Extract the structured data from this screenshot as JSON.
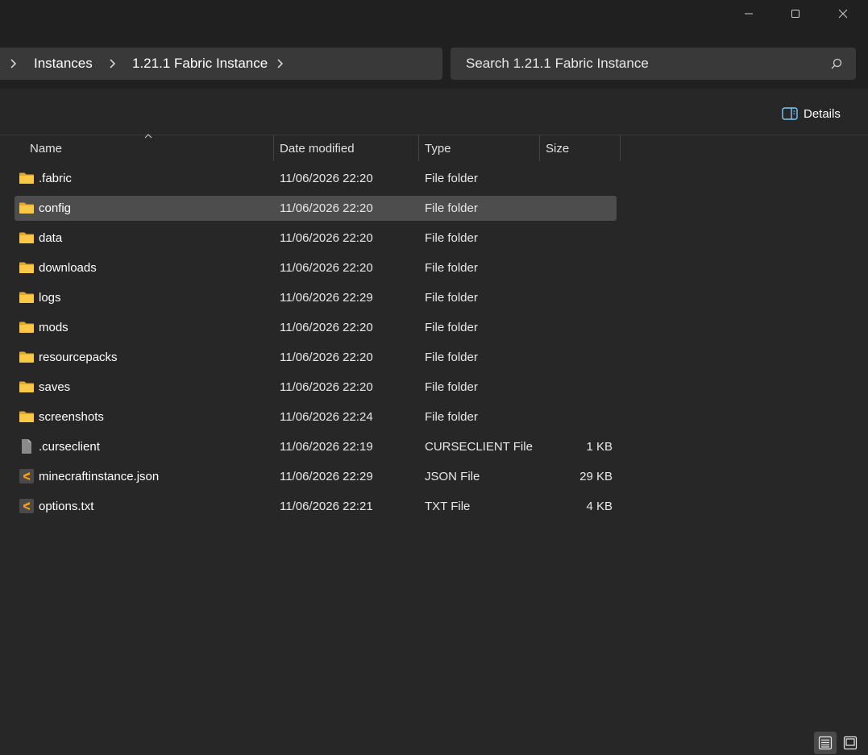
{
  "window": {
    "minimize_label": "—",
    "maximize_label": "□",
    "close_label": "✕"
  },
  "breadcrumb": {
    "items": [
      "Instances",
      "1.21.1 Fabric Instance"
    ]
  },
  "search": {
    "placeholder": "Search 1.21.1 Fabric Instance"
  },
  "toolbar": {
    "details_label": "Details"
  },
  "columns": {
    "name": "Name",
    "date": "Date modified",
    "type": "Type",
    "size": "Size"
  },
  "files": [
    {
      "name": ".fabric",
      "date": "11/06/2026 22:20",
      "type": "File folder",
      "size": "",
      "icon": "folder-icon"
    },
    {
      "name": "config",
      "date": "11/06/2026 22:20",
      "type": "File folder",
      "size": "",
      "icon": "folder-icon",
      "selected": true
    },
    {
      "name": "data",
      "date": "11/06/2026 22:20",
      "type": "File folder",
      "size": "",
      "icon": "folder-icon"
    },
    {
      "name": "downloads",
      "date": "11/06/2026 22:20",
      "type": "File folder",
      "size": "",
      "icon": "folder-icon"
    },
    {
      "name": "logs",
      "date": "11/06/2026 22:29",
      "type": "File folder",
      "size": "",
      "icon": "folder-icon"
    },
    {
      "name": "mods",
      "date": "11/06/2026 22:20",
      "type": "File folder",
      "size": "",
      "icon": "folder-icon"
    },
    {
      "name": "resourcepacks",
      "date": "11/06/2026 22:20",
      "type": "File folder",
      "size": "",
      "icon": "folder-icon"
    },
    {
      "name": "saves",
      "date": "11/06/2026 22:20",
      "type": "File folder",
      "size": "",
      "icon": "folder-icon"
    },
    {
      "name": "screenshots",
      "date": "11/06/2026 22:24",
      "type": "File folder",
      "size": "",
      "icon": "folder-icon"
    },
    {
      "name": ".curseclient",
      "date": "11/06/2026 22:19",
      "type": "CURSECLIENT File",
      "size": "1 KB",
      "icon": "generic-file-icon"
    },
    {
      "name": "minecraftinstance.json",
      "date": "11/06/2026 22:29",
      "type": "JSON File",
      "size": "29 KB",
      "icon": "sublime-file-icon"
    },
    {
      "name": "options.txt",
      "date": "11/06/2026 22:21",
      "type": "TXT File",
      "size": "4 KB",
      "icon": "sublime-file-icon"
    }
  ],
  "colors": {
    "background": "#272727",
    "chrome": "#202020",
    "field": "#393939",
    "selection": "#4d4d4d",
    "folder": "#f8c846"
  }
}
